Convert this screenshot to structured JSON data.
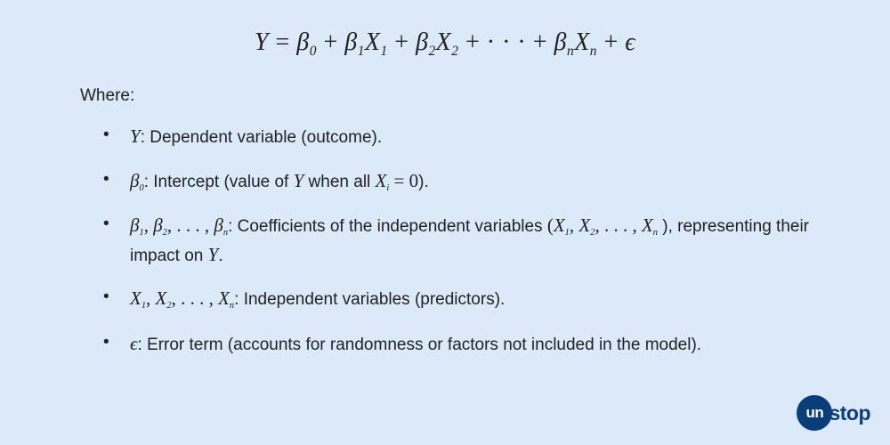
{
  "equation": {
    "display": "Y = β₀ + β₁X₁ + β₂X₂ + ⋯ + βₙXₙ + ϵ",
    "lhs": "Y",
    "terms": [
      {
        "symbol": "β",
        "sub": "0"
      },
      {
        "symbol": "β",
        "sub": "1",
        "var": "X",
        "varsub": "1"
      },
      {
        "symbol": "β",
        "sub": "2",
        "var": "X",
        "varsub": "2"
      },
      {
        "ellipsis": true
      },
      {
        "symbol": "β",
        "sub": "n",
        "var": "X",
        "varsub": "n"
      },
      {
        "error": "ϵ"
      }
    ]
  },
  "where_label": "Where:",
  "definitions": [
    {
      "term_html": "<span class='m'>Y</span>",
      "desc": ": Dependent variable (outcome)."
    },
    {
      "term_html": "<span class='m'>β</span><span class='m s'>0</span>",
      "desc_prefix": ": Intercept (value of ",
      "desc_mid_html": "<span class='m'>Y </span>",
      "desc_mid2": " when all ",
      "desc_mid3_html": "<span class='m'>X</span><span class='m s'>i</span> <span class='mn eq'>= 0</span>",
      "desc_suffix": ")."
    },
    {
      "term_html": "<span class='m'>β</span><span class='m s'>1</span><span class='mn'>, </span><span class='m'>β</span><span class='m s'>2</span><span class='mn'>, . . . , </span><span class='m'>β</span><span class='m s'>n</span>",
      "desc_prefix": ": Coefficients of the independent variables ",
      "desc_mid_html": "<span class='mn'>(</span><span class='m'>X</span><span class='m s'>1</span><span class='mn'>, </span><span class='m'>X</span><span class='m s'>2</span><span class='mn'>, . . . , </span><span class='m'>X</span><span class='m s'>n</span>",
      "desc_mid2": " ), representing their impact on ",
      "desc_mid3_html": "<span class='m'>Y</span>",
      "desc_suffix": "."
    },
    {
      "term_html": "<span class='m'>X</span><span class='m s'>1</span><span class='mn'>, </span><span class='m'>X</span><span class='m s'>2</span><span class='mn'>, . . . , </span><span class='m'>X</span><span class='m s'>n</span>",
      "desc": ": Independent variables (predictors)."
    },
    {
      "term_html": "<span class='m'>ϵ</span>",
      "desc": ": Error term (accounts for randomness or factors not included in the model)."
    }
  ],
  "logo": {
    "circle_text": "un",
    "rest_text": "stop"
  }
}
